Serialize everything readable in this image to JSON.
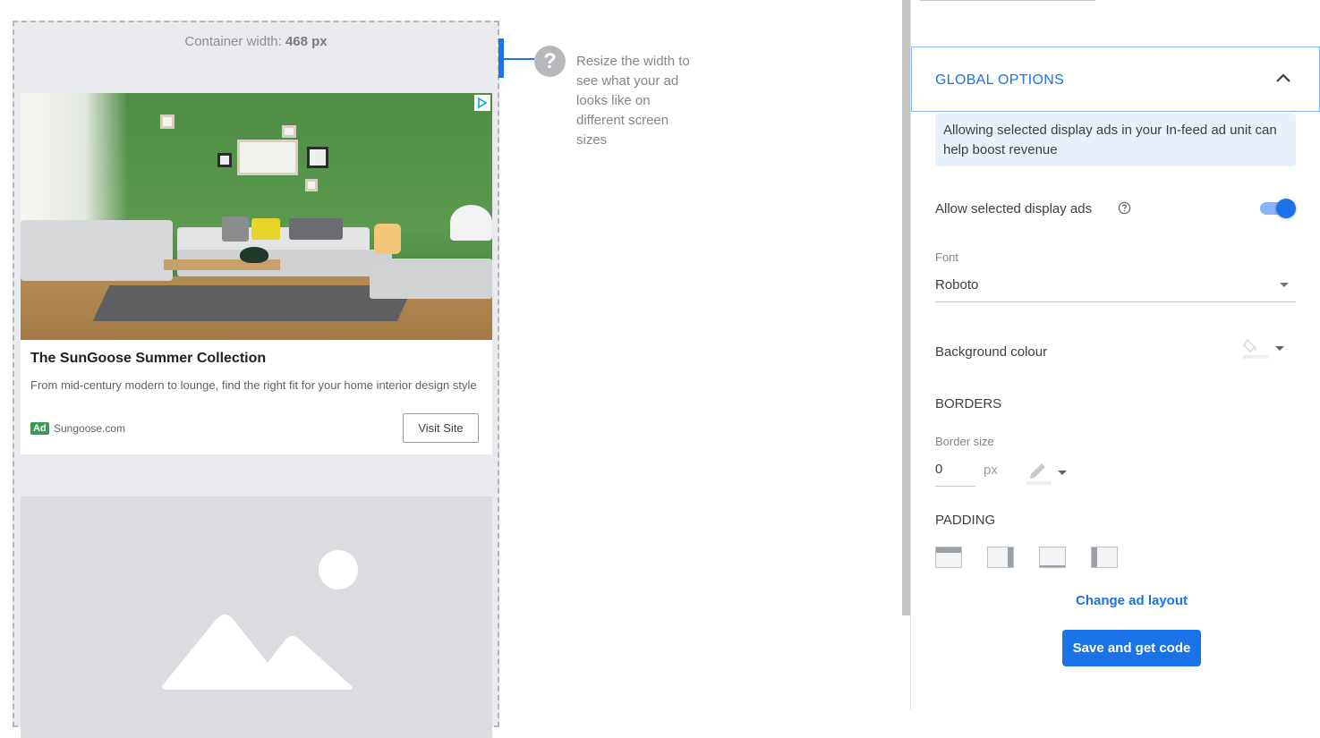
{
  "preview": {
    "container_width_label": "Container width:",
    "container_width_value": "468 px",
    "ad": {
      "title": "The SunGoose Summer Collection",
      "description": "From mid-century modern to lounge, find the right fit for your home interior design style",
      "badge": "Ad",
      "domain": "Sungoose.com",
      "cta": "Visit Site",
      "adchoices_icon": "adchoices-icon"
    },
    "help_icon": "question-circle-icon",
    "help_text": "Resize the width to see what your ad looks like on different screen sizes"
  },
  "panel": {
    "global_options": {
      "title": "GLOBAL OPTIONS",
      "expanded": true,
      "info": "Allowing selected display ads in your In-feed ad unit can help boost revenue",
      "allow_display_ads_label": "Allow selected display ads",
      "allow_display_ads_on": true,
      "font_label": "Font",
      "font_value": "Roboto",
      "background_label": "Background colour",
      "borders_heading": "BORDERS",
      "border_size_label": "Border size",
      "border_size_value": "0",
      "border_size_unit": "px",
      "padding_heading": "PADDING"
    },
    "change_layout_link": "Change ad layout",
    "save_button": "Save and get code"
  },
  "colors": {
    "accent": "#1a73e8",
    "info_bg": "#e8f0fe",
    "toggle_track": "#8ab4f8",
    "ad_badge": "#3a9a52"
  }
}
